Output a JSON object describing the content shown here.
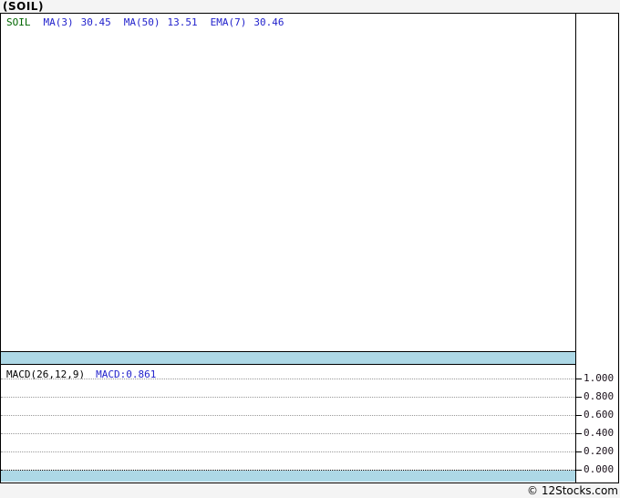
{
  "page": {
    "title": "(SOIL)",
    "footer_credit": "© 12Stocks.com"
  },
  "colors": {
    "symbol_green": "#006600",
    "indicator_blue": "#2222cc",
    "band_blue": "#ADD8E6",
    "grid_gray": "#999999",
    "page_background": "#f4f4f4"
  },
  "price_pane": {
    "legend": {
      "symbol": "SOIL",
      "indicators": [
        {
          "label": "MA(3)",
          "value": "30.45"
        },
        {
          "label": "MA(50)",
          "value": "13.51"
        },
        {
          "label": "EMA(7)",
          "value": "30.46"
        }
      ]
    }
  },
  "macd_pane": {
    "legend_label": "MACD(26,12,9)",
    "legend_value": "MACD:0.861",
    "axis_ticks": [
      "1.000",
      "0.800",
      "0.600",
      "0.400",
      "0.200",
      "0.000"
    ]
  },
  "chart_data": [
    {
      "type": "line",
      "title": "(SOIL)",
      "pane": "price",
      "legend": [
        "SOIL",
        "MA(3) 30.45",
        "MA(50) 13.51",
        "EMA(7) 30.46"
      ],
      "series": [],
      "grid": false,
      "note_values": {
        "MA(3)": 30.45,
        "MA(50)": 13.51,
        "EMA(7)": 30.46
      }
    },
    {
      "type": "line",
      "title": "MACD(26,12,9)",
      "pane": "macd",
      "legend": [
        "MACD:0.861"
      ],
      "macd_value": 0.861,
      "yticks": [
        1.0,
        0.8,
        0.6,
        0.4,
        0.2,
        0.0
      ],
      "ylim": [
        0.0,
        1.05
      ],
      "grid": true,
      "legend_position": "top-left",
      "series": []
    }
  ]
}
